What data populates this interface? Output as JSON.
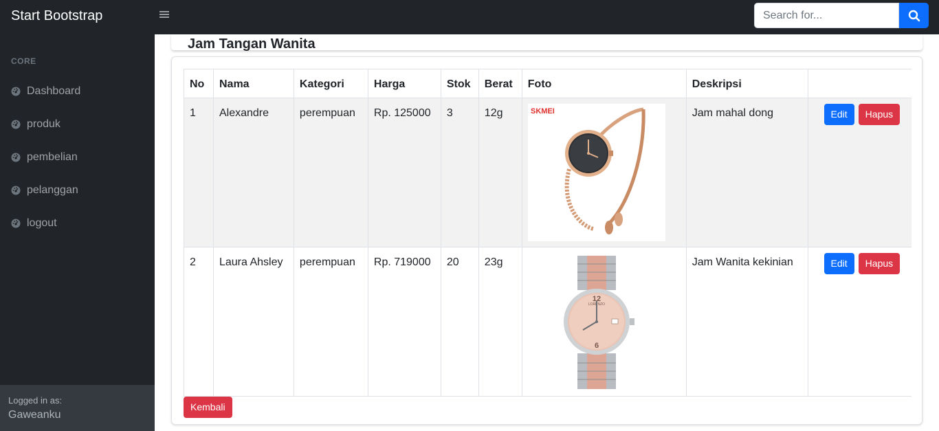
{
  "nav": {
    "brand": "Start Bootstrap",
    "search_placeholder": "Search for..."
  },
  "sidebar": {
    "heading": "CORE",
    "items": [
      {
        "label": "Dashboard",
        "icon": "tachometer-icon"
      },
      {
        "label": "produk",
        "icon": "tachometer-icon"
      },
      {
        "label": "pembelian",
        "icon": "tachometer-icon"
      },
      {
        "label": "pelanggan",
        "icon": "tachometer-icon"
      },
      {
        "label": "logout",
        "icon": "tachometer-icon"
      }
    ],
    "footer": {
      "label": "Logged in as:",
      "user": "Gaweanku"
    }
  },
  "page": {
    "title": "Jam Tangan Wanita"
  },
  "table": {
    "headers": [
      "No",
      "Nama",
      "Kategori",
      "Harga",
      "Stok",
      "Berat",
      "Foto",
      "Deskripsi",
      ""
    ],
    "rows": [
      {
        "no": "1",
        "nama": "Alexandre",
        "kategori": "perempuan",
        "harga": "Rp. 125000",
        "stok": "3",
        "berat": "12g",
        "foto_brand": "SKMEI",
        "deskripsi": "Jam mahal dong"
      },
      {
        "no": "2",
        "nama": "Laura Ahsley",
        "kategori": "perempuan",
        "harga": "Rp. 719000",
        "stok": "20",
        "berat": "23g",
        "foto_brand": "LORENZO",
        "deskripsi": "Jam Wanita kekinian"
      }
    ],
    "edit_label": "Edit",
    "delete_label": "Hapus"
  },
  "back_label": "Kembali",
  "colors": {
    "dark": "#212529",
    "primary": "#0d6efd",
    "danger": "#dc3545"
  }
}
